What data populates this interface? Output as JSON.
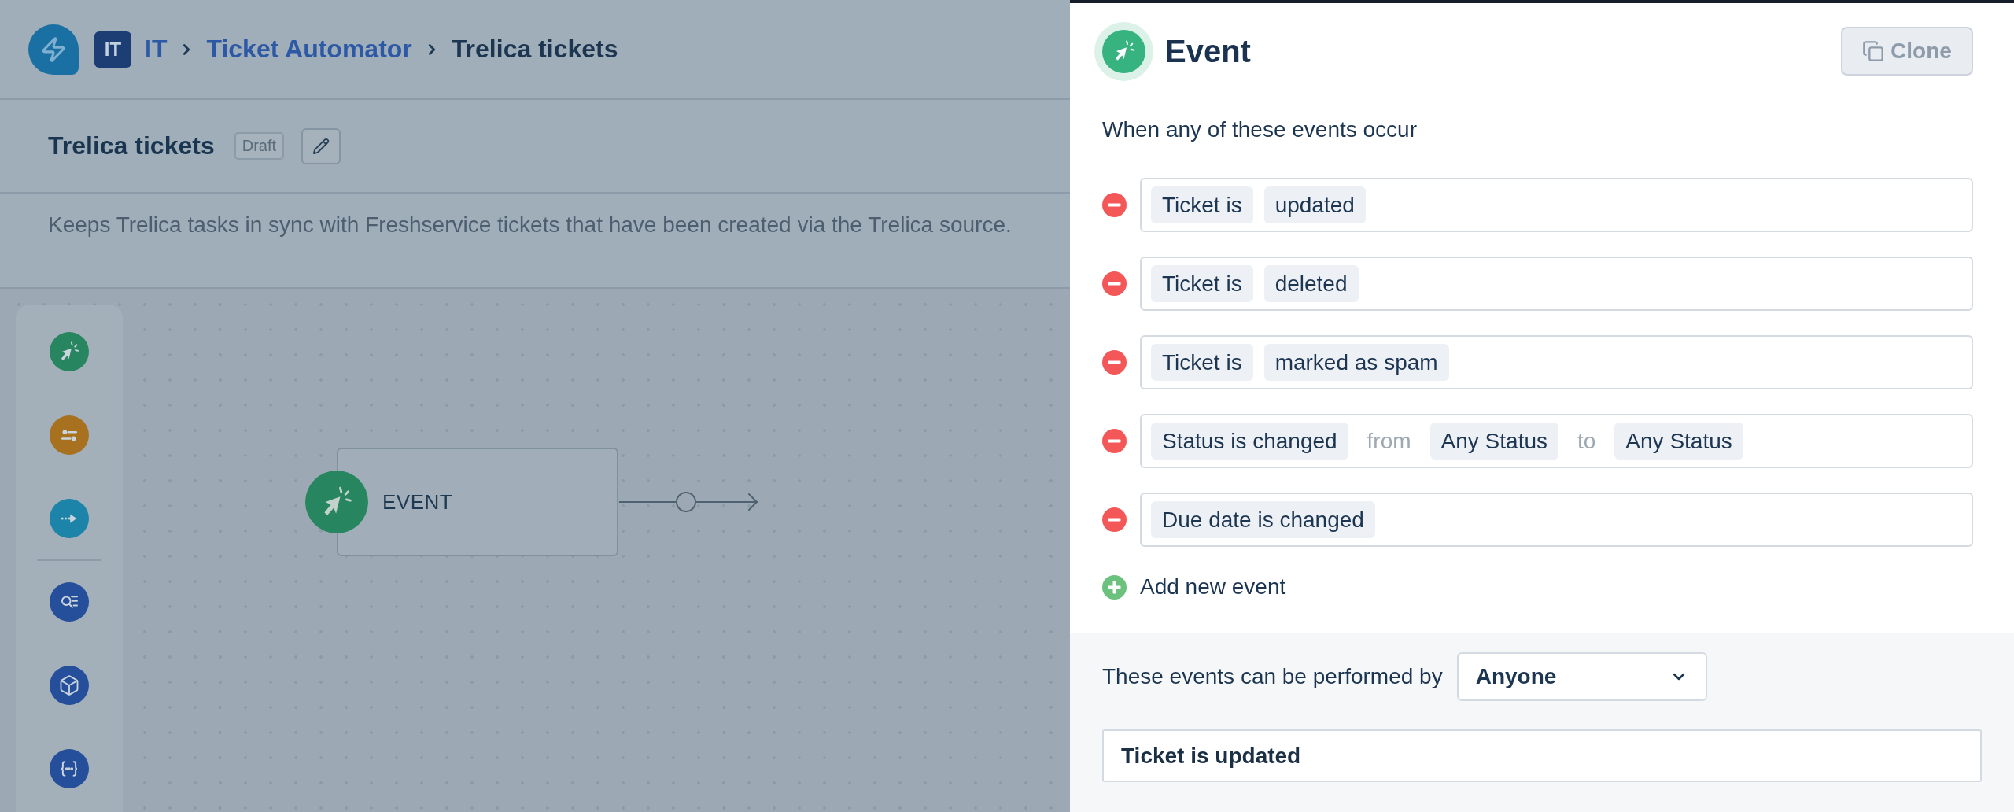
{
  "header": {
    "workspace_badge": "IT",
    "breadcrumbs": [
      {
        "label": "IT",
        "current": false
      },
      {
        "label": "Ticket Automator",
        "current": false
      },
      {
        "label": "Trelica tickets",
        "current": true
      }
    ]
  },
  "workflow": {
    "title": "Trelica tickets",
    "status": "Draft",
    "description": "Keeps Trelica tasks in sync with Freshservice tickets that have been created via the Trelica source."
  },
  "palette": {
    "groups": [
      [
        {
          "kind": "event",
          "color": "#27855f"
        },
        {
          "kind": "condition",
          "color": "#a8711f"
        },
        {
          "kind": "action",
          "color": "#1b84a8"
        }
      ],
      [
        {
          "kind": "search",
          "color": "#254f9b"
        },
        {
          "kind": "app",
          "color": "#254f9b"
        },
        {
          "kind": "expression",
          "color": "#254f9b"
        }
      ]
    ]
  },
  "canvas": {
    "nodes": [
      {
        "kind": "event",
        "label": "EVENT"
      }
    ]
  },
  "panel": {
    "title": "Event",
    "clone_button": {
      "label": "Clone",
      "disabled": true
    },
    "intro": "When any of these events occur",
    "events": [
      {
        "parts": [
          {
            "kind": "chip",
            "text": "Ticket is"
          },
          {
            "kind": "chip",
            "text": "updated"
          }
        ]
      },
      {
        "parts": [
          {
            "kind": "chip",
            "text": "Ticket is"
          },
          {
            "kind": "chip",
            "text": "deleted"
          }
        ]
      },
      {
        "parts": [
          {
            "kind": "chip",
            "text": "Ticket is"
          },
          {
            "kind": "chip",
            "text": "marked as spam"
          }
        ]
      },
      {
        "parts": [
          {
            "kind": "chip",
            "text": "Status is changed"
          },
          {
            "kind": "text",
            "text": "from"
          },
          {
            "kind": "chip",
            "text": "Any Status"
          },
          {
            "kind": "text",
            "text": "to"
          },
          {
            "kind": "chip",
            "text": "Any Status"
          }
        ]
      },
      {
        "parts": [
          {
            "kind": "chip",
            "text": "Due date is changed"
          }
        ]
      }
    ],
    "add_event": "Add new event",
    "performed_by": {
      "label": "These events can be performed by",
      "value": "Anyone"
    },
    "summary": "Ticket is updated"
  }
}
